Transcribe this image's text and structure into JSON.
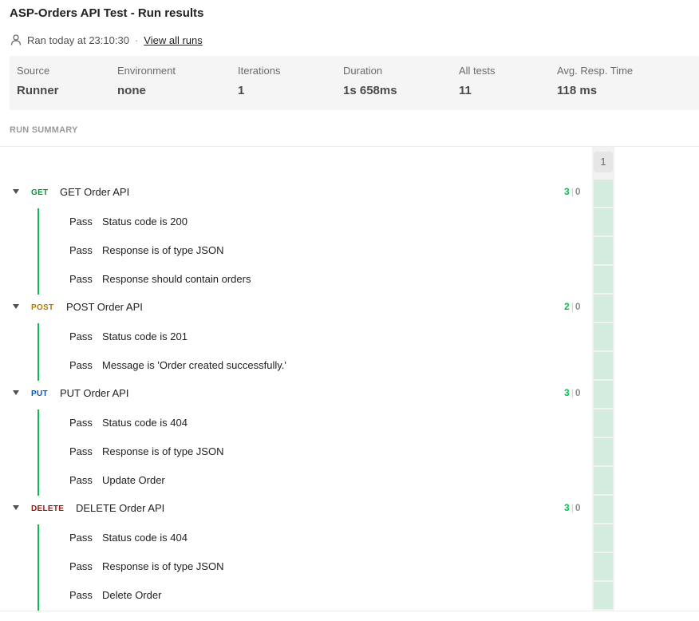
{
  "header": {
    "title": "ASP-Orders API Test - Run results",
    "ran_text": "Ran today at 23:10:30",
    "separator": "·",
    "view_all_runs": "View all runs"
  },
  "stats": [
    {
      "label": "Source",
      "value": "Runner"
    },
    {
      "label": "Environment",
      "value": "none"
    },
    {
      "label": "Iterations",
      "value": "1"
    },
    {
      "label": "Duration",
      "value": "1s 658ms"
    },
    {
      "label": "All tests",
      "value": "11"
    },
    {
      "label": "Avg. Resp. Time",
      "value": "118 ms"
    }
  ],
  "summary": {
    "section_label": "RUN SUMMARY",
    "iteration_header": "1",
    "count_separator": "|",
    "requests": [
      {
        "method": "GET",
        "method_color": "#0f8a38",
        "name": "GET Order API",
        "passed": "3",
        "failed": "0",
        "tests": [
          {
            "status": "Pass",
            "name": "Status code is 200"
          },
          {
            "status": "Pass",
            "name": "Response is of type JSON"
          },
          {
            "status": "Pass",
            "name": "Response should contain orders"
          }
        ]
      },
      {
        "method": "POST",
        "method_color": "#ad7a03",
        "name": "POST Order API",
        "passed": "2",
        "failed": "0",
        "tests": [
          {
            "status": "Pass",
            "name": "Status code is 201"
          },
          {
            "status": "Pass",
            "name": "Message is 'Order created successfully.'"
          }
        ]
      },
      {
        "method": "PUT",
        "method_color": "#0053b8",
        "name": "PUT Order API",
        "passed": "3",
        "failed": "0",
        "tests": [
          {
            "status": "Pass",
            "name": "Status code is 404"
          },
          {
            "status": "Pass",
            "name": "Response is of type JSON"
          },
          {
            "status": "Pass",
            "name": "Update Order"
          }
        ]
      },
      {
        "method": "DELETE",
        "method_color": "#8e1a10",
        "name": "DELETE Order API",
        "passed": "3",
        "failed": "0",
        "tests": [
          {
            "status": "Pass",
            "name": "Status code is 404"
          },
          {
            "status": "Pass",
            "name": "Response is of type JSON"
          },
          {
            "status": "Pass",
            "name": "Delete Order"
          }
        ]
      }
    ]
  },
  "colors": {
    "pass_count": "#0cbb52",
    "pass_cell": "#d4ecde",
    "tree_line": "#0cbb52"
  },
  "icons": {
    "user": "user-icon",
    "caret": "caret-down-icon"
  }
}
